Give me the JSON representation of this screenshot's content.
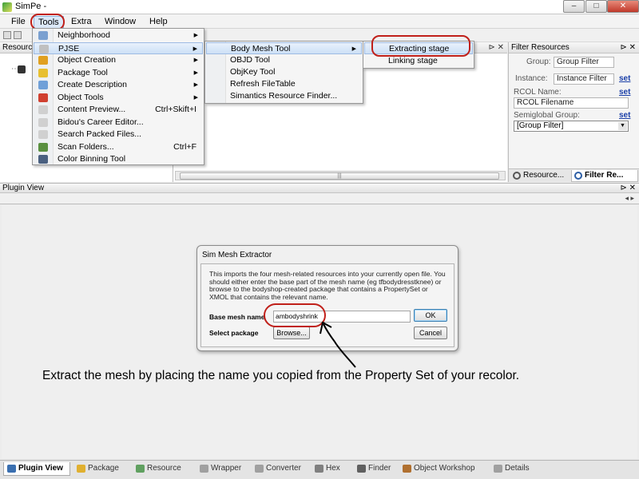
{
  "window": {
    "title": "SimPe -"
  },
  "menubar": [
    "File",
    "Tools",
    "Extra",
    "Window",
    "Help"
  ],
  "panels": {
    "resource_title": "Resourc",
    "filter_title": "Filter Resources",
    "plugin_title": "Plugin View"
  },
  "tools_menu": [
    {
      "label": "Neighborhood",
      "submenu": true,
      "icon_color": "#7aa0d0"
    },
    {
      "label": "PJSE",
      "submenu": true,
      "icon_color": "#c0c0c0"
    },
    {
      "label": "Object Creation",
      "submenu": true,
      "icon_color": "#e0a020"
    },
    {
      "label": "Package Tool",
      "submenu": true,
      "icon_color": "#e8c030"
    },
    {
      "label": "Create Description",
      "submenu": true,
      "icon_color": "#70a0d8"
    },
    {
      "label": "Object Tools",
      "submenu": true,
      "icon_color": "#d04030"
    },
    {
      "label": "Content Preview...",
      "shortcut": "Ctrl+Skift+I",
      "icon_color": "#d0d0d0"
    },
    {
      "label": "Bidou's Career Editor...",
      "icon_color": "#d0d0d0"
    },
    {
      "label": "Search Packed Files...",
      "icon_color": "#d0d0d0"
    },
    {
      "label": "Scan Folders...",
      "shortcut": "Ctrl+F",
      "icon_color": "#5a9040"
    },
    {
      "label": "Color Binning Tool",
      "icon_color": "#4a6080"
    }
  ],
  "pjse_menu": [
    "Body Mesh Tool",
    "OBJD Tool",
    "ObjKey Tool",
    "Refresh FileTable",
    "Simantics Resource Finder..."
  ],
  "body_mesh_menu": [
    "Extracting stage",
    "Linking stage"
  ],
  "filter": {
    "group_label": "Group:",
    "group_value": "Group Filter",
    "instance_label": "Instance:",
    "instance_value": "Instance Filter",
    "set": "set",
    "rcol_label": "RCOL Name:",
    "rcol_value": "RCOL Filename",
    "semiglobal_label": "Semiglobal Group:",
    "semiglobal_value": "[Group Filter]",
    "tab_resource": "Resource...",
    "tab_filter": "Filter Re..."
  },
  "dialog": {
    "title": "Sim Mesh Extractor",
    "description": "This imports the four mesh-related resources into your currently open file. You should either enter the base part of the mesh name (eg tfbodydresstknee) or browse to the bodyshop-created package that contains a PropertySet or XMOL that contains the relevant name.",
    "base_label": "Base mesh name",
    "base_value": "ambodyshrink",
    "select_label": "Select package",
    "browse": "Browse...",
    "ok": "OK",
    "cancel": "Cancel"
  },
  "caption": "Extract the mesh by placing the name you copied from the Property Set of your recolor.",
  "bottom_tabs": [
    {
      "label": "Plugin View",
      "icon_color": "#3a6fb0"
    },
    {
      "label": "Package",
      "icon_color": "#e0b030"
    },
    {
      "label": "Resource",
      "icon_color": "#60a060"
    },
    {
      "label": "Wrapper",
      "icon_color": "#a0a0a0"
    },
    {
      "label": "Converter",
      "icon_color": "#a0a0a0"
    },
    {
      "label": "Hex",
      "icon_color": "#808080"
    },
    {
      "label": "Finder",
      "icon_color": "#606060"
    },
    {
      "label": "Object Workshop",
      "icon_color": "#b07030"
    },
    {
      "label": "Details",
      "icon_color": "#a0a0a0"
    }
  ],
  "accent_color": "#c0201a"
}
